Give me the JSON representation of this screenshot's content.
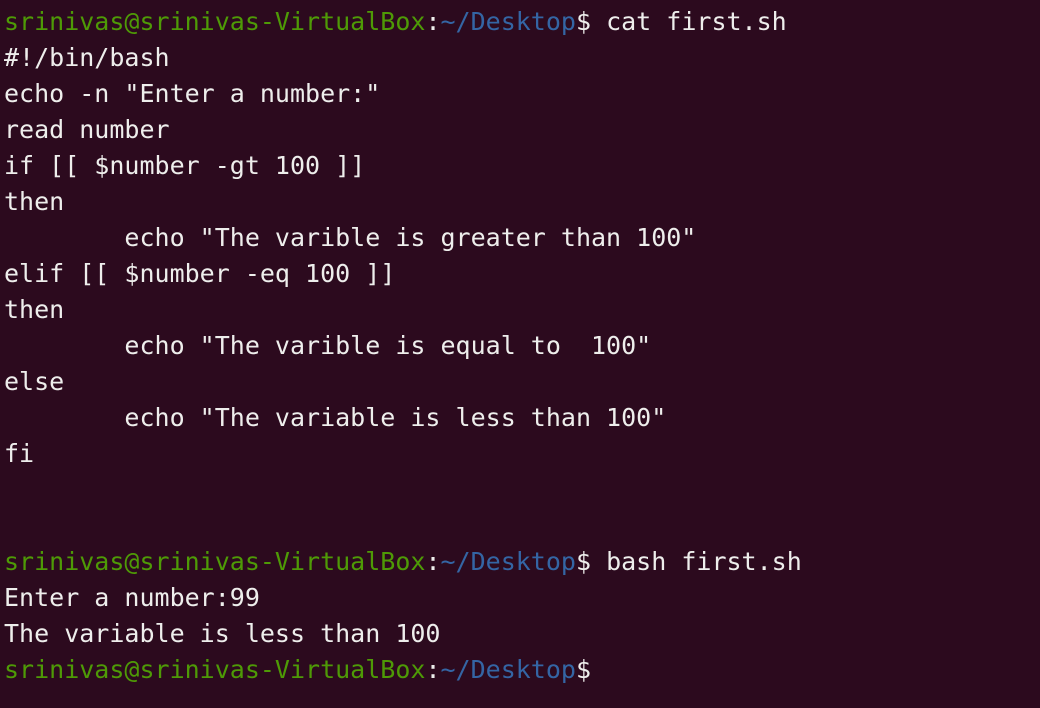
{
  "terminal": {
    "app": "GNOME Terminal",
    "colors": {
      "background": "#2c0a1e",
      "foreground": "#eeeeec",
      "prompt_user_host": "#4e9a06",
      "prompt_path": "#3465a4",
      "prompt_symbol": "#eeeeec"
    },
    "prompt": {
      "user_host": "srinivas@srinivas-VirtualBox",
      "separator": ":",
      "path": "~/Desktop",
      "symbol": "$"
    },
    "lines": [
      {
        "type": "prompt",
        "user_host": "srinivas@srinivas-VirtualBox",
        "separator": ":",
        "path": "~/Desktop",
        "symbol": "$",
        "command": " cat first.sh"
      },
      {
        "type": "output",
        "text": "#!/bin/bash"
      },
      {
        "type": "output",
        "text": "echo -n \"Enter a number:\""
      },
      {
        "type": "output",
        "text": "read number"
      },
      {
        "type": "output",
        "text": "if [[ $number -gt 100 ]]"
      },
      {
        "type": "output",
        "text": "then"
      },
      {
        "type": "output",
        "text": "        echo \"The varible is greater than 100\""
      },
      {
        "type": "output",
        "text": "elif [[ $number -eq 100 ]]"
      },
      {
        "type": "output",
        "text": "then"
      },
      {
        "type": "output",
        "text": "        echo \"The varible is equal to  100\""
      },
      {
        "type": "output",
        "text": "else"
      },
      {
        "type": "output",
        "text": "        echo \"The variable is less than 100\""
      },
      {
        "type": "output",
        "text": "fi"
      },
      {
        "type": "blank",
        "text": ""
      },
      {
        "type": "blank",
        "text": ""
      },
      {
        "type": "prompt",
        "user_host": "srinivas@srinivas-VirtualBox",
        "separator": ":",
        "path": "~/Desktop",
        "symbol": "$",
        "command": " bash first.sh"
      },
      {
        "type": "output",
        "text": "Enter a number:99"
      },
      {
        "type": "output",
        "text": "The variable is less than 100"
      },
      {
        "type": "prompt",
        "user_host": "srinivas@srinivas-VirtualBox",
        "separator": ":",
        "path": "~/Desktop",
        "symbol": "$",
        "command": ""
      }
    ]
  }
}
